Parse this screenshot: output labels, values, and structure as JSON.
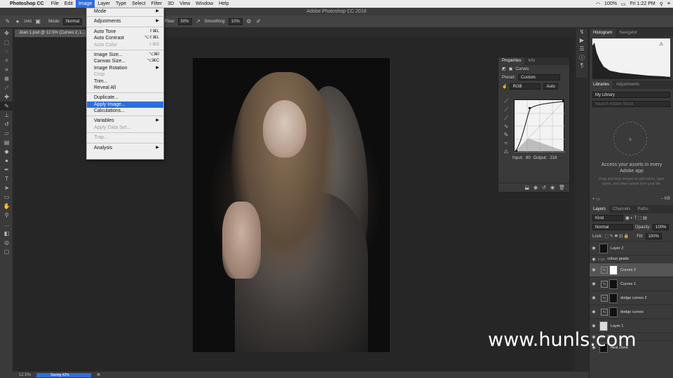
{
  "menubar": {
    "app_name": "Photoshop CC",
    "items": [
      "File",
      "Edit",
      "Image",
      "Layer",
      "Type",
      "Select",
      "Filter",
      "3D",
      "View",
      "Window",
      "Help"
    ],
    "active": "Image",
    "battery": "100%",
    "clock": "Fri 1:22 PM"
  },
  "titlebar": {
    "title": "Adobe Photoshop CC 2018"
  },
  "options": {
    "brush_size": "1043",
    "mode_label": "Mode:",
    "mode_value": "Normal",
    "flow_label": "Flow:",
    "flow_value": "50%",
    "smoothing_label": "Smoothing:",
    "smoothing_value": "10%"
  },
  "document": {
    "tab_label": "Joan 1.psd @ 12.5% (Curves 2, L..."
  },
  "image_menu": [
    {
      "label": "Mode",
      "submenu": true
    },
    {
      "sep": true
    },
    {
      "label": "Adjustments",
      "submenu": true
    },
    {
      "sep": true
    },
    {
      "label": "Auto Tone",
      "shortcut": "⇧⌘L"
    },
    {
      "label": "Auto Contrast",
      "shortcut": "⌥⇧⌘L"
    },
    {
      "label": "Auto Color",
      "shortcut": "⇧⌘B",
      "disabled": true
    },
    {
      "sep": true
    },
    {
      "label": "Image Size...",
      "shortcut": "⌥⌘I"
    },
    {
      "label": "Canvas Size...",
      "shortcut": "⌥⌘C"
    },
    {
      "label": "Image Rotation",
      "submenu": true
    },
    {
      "label": "Crop",
      "disabled": true
    },
    {
      "label": "Trim..."
    },
    {
      "label": "Reveal All"
    },
    {
      "sep": true
    },
    {
      "label": "Duplicate..."
    },
    {
      "label": "Apply Image...",
      "highlighted": true
    },
    {
      "label": "Calculations..."
    },
    {
      "sep": true
    },
    {
      "label": "Variables",
      "submenu": true
    },
    {
      "label": "Apply Data Set...",
      "disabled": true
    },
    {
      "sep": true
    },
    {
      "label": "Trap...",
      "disabled": true
    },
    {
      "sep": true
    },
    {
      "label": "Analysis",
      "submenu": true
    }
  ],
  "properties": {
    "tabs": [
      "Properties",
      "Info"
    ],
    "adjustment": "Curves",
    "preset_label": "Preset:",
    "preset_value": "Custom",
    "channel": "RGB",
    "auto_button": "Auto",
    "input_label": "Input:",
    "input_value": "80",
    "output_label": "Output:",
    "output_value": "216"
  },
  "histogram_panel": {
    "tabs": [
      "Histogram",
      "Navigator"
    ]
  },
  "libraries_panel": {
    "tabs": [
      "Libraries",
      "Adjustments"
    ],
    "library": "My Library",
    "search_placeholder": "Search Adobe Stock",
    "message": "Access your assets in every Adobe app",
    "sub_message": "Drag and drop images or add colors, layer styles, and other assets from your file.",
    "size": "-- KB"
  },
  "layers_panel": {
    "tabs": [
      "Layers",
      "Channels",
      "Paths"
    ],
    "kind_label": "Kind",
    "blend_mode": "Normal",
    "opacity_label": "Opacity:",
    "opacity_value": "100%",
    "lock_label": "Lock:",
    "fill_label": "Fill:",
    "fill_value": "100%",
    "layers": [
      {
        "name": "Layer 2",
        "type": "layer"
      },
      {
        "name": "colour grade",
        "type": "group"
      },
      {
        "name": "Curves 2",
        "type": "adjust",
        "selected": true
      },
      {
        "name": "Curves 1",
        "type": "adjust"
      },
      {
        "name": "dodge curves 2",
        "type": "adjust"
      },
      {
        "name": "dodge curves",
        "type": "adjust"
      },
      {
        "name": "Layer 1",
        "type": "layer"
      },
      {
        "name": "skin",
        "type": "group"
      },
      {
        "name": "heal clone",
        "type": "layer"
      }
    ]
  },
  "status": {
    "zoom": "12.5%",
    "progress_label": "Saving 42%",
    "progress": 0.42
  },
  "watermark": "www.hunls.com"
}
